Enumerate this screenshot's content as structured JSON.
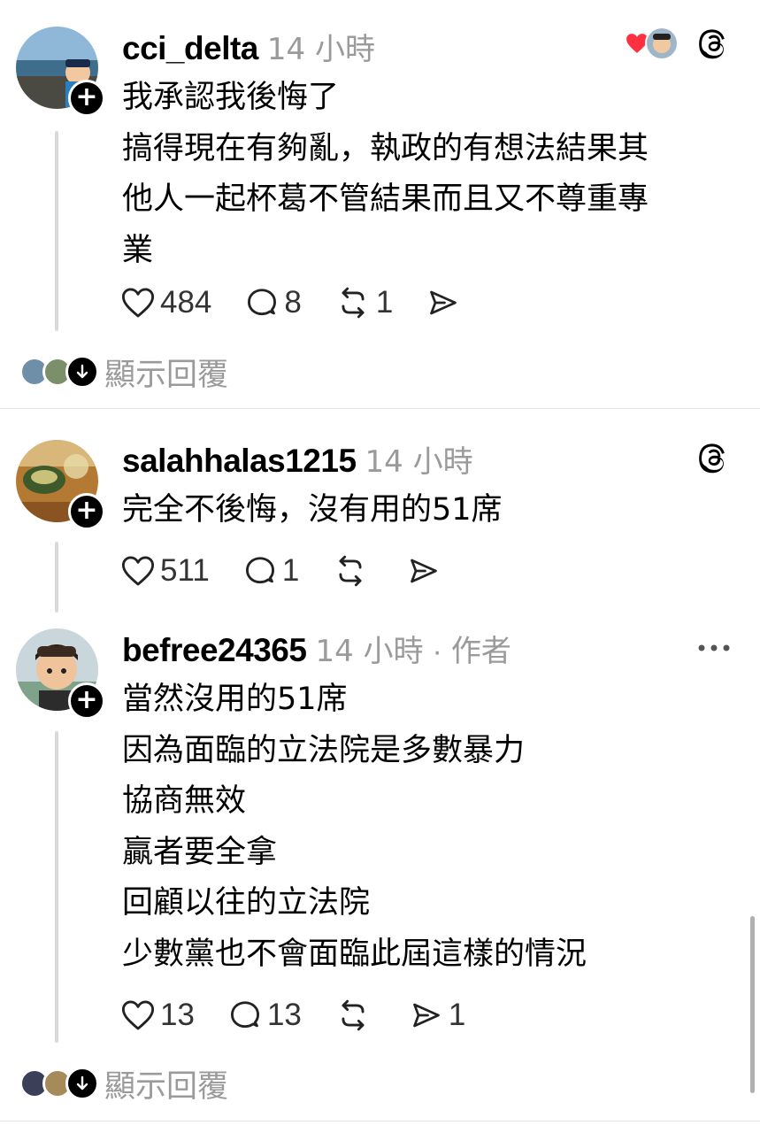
{
  "posts": [
    {
      "username": "cci_delta",
      "time": "14 小時",
      "lines": [
        "我承認我後悔了",
        "搞得現在有夠亂，執政的有想法結果其",
        "他人一起杯葛不管結果而且又不尊重專",
        "業"
      ],
      "likes": "484",
      "comments": "8",
      "reposts": "1",
      "shares": ""
    },
    {
      "username": "salahhalas1215",
      "time": "14 小時",
      "lines": [
        "完全不後悔，沒有用的51席"
      ],
      "likes": "511",
      "comments": "1",
      "reposts": "",
      "shares": ""
    },
    {
      "username": "befree24365",
      "time": "14 小時",
      "author_tag": "作者",
      "separator": "·",
      "lines": [
        "當然沒用的51席",
        "因為面臨的立法院是多數暴力",
        "協商無效",
        "贏者要全拿",
        "回顧以往的立法院",
        "少數黨也不會面臨此屆這樣的情況"
      ],
      "likes": "13",
      "comments": "13",
      "reposts": "",
      "shares": "1"
    }
  ],
  "show_replies_label": "顯示回覆",
  "follow_symbol": "+",
  "icons": {
    "like": "heart-outline-icon",
    "comment": "speech-bubble-icon",
    "repost": "repost-arrows-icon",
    "share": "paper-plane-icon",
    "threads": "threads-logo-icon",
    "more": "ellipsis-icon",
    "expand": "arrow-down-icon",
    "liked": "heart-filled-icon"
  },
  "colors": {
    "text": "#000000",
    "muted": "#9a9a9a",
    "line": "#d9d9d9",
    "heart": "#ff3040"
  }
}
